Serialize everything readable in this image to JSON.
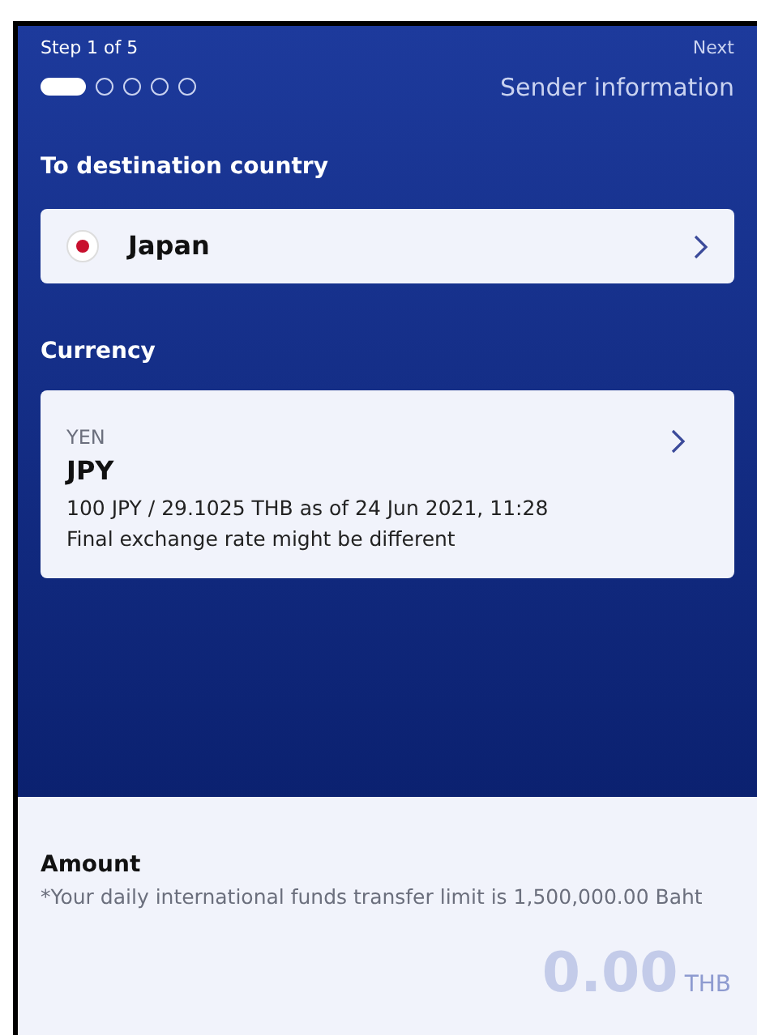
{
  "header": {
    "step_label": "Step 1 of 5",
    "next_label": "Next",
    "next_step": "Sender information"
  },
  "steps": [
    {
      "selected": true
    },
    {
      "selected": false
    },
    {
      "selected": false
    },
    {
      "selected": false
    },
    {
      "selected": false
    }
  ],
  "destination": {
    "label": "To destination country",
    "country": "Japan"
  },
  "currency": {
    "label": "Currency",
    "name": "YEN",
    "code": "JPY",
    "rate": "100 JPY / 29.1025 THB as of 24 Jun 2021, 11:28",
    "note": "Final exchange rate might be different"
  },
  "amount": {
    "label": "Amount",
    "limit_note": "*Your daily international funds transfer limit is 1,500,000.00 Baht",
    "placeholder": "0.00",
    "unit": "THB"
  }
}
